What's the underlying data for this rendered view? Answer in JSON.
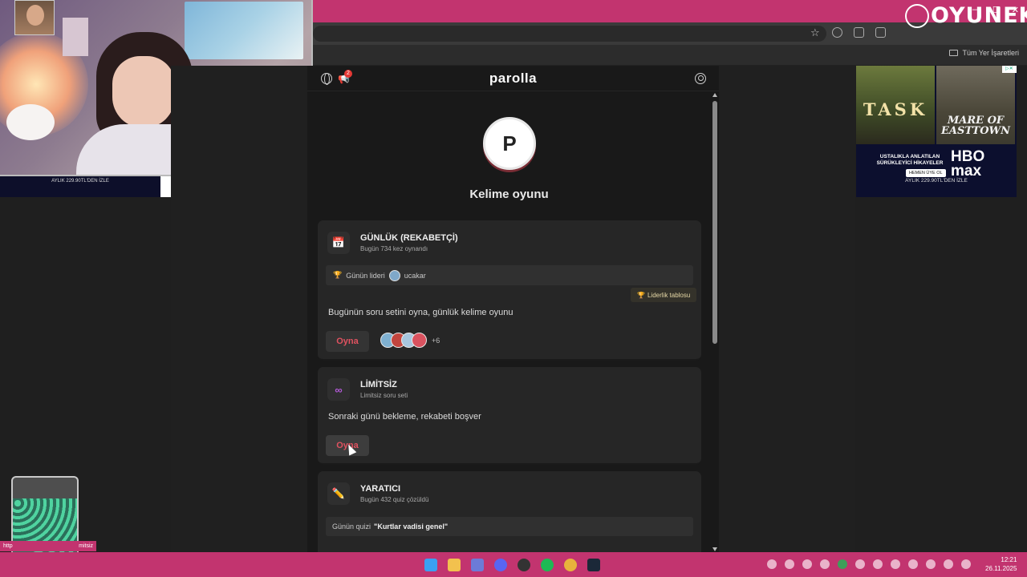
{
  "browser": {
    "bookmark_folder": "Tüm Yer İşaretleri"
  },
  "brand": {
    "text": "OYUNEKS"
  },
  "left_ad": {
    "price": "AYLIK 229.90TL'DEN İZLE"
  },
  "ad": {
    "poster1_title": "TASK",
    "poster2_title": "MARE OF EASTTOWN",
    "tagline": "USTALIKLA ANLATILAN SÜRÜKLEYİCİ HİKAYELER",
    "cta": "HEMEN ÜYE OL",
    "hbo": "HBO",
    "max": "max",
    "price": "AYLIK 229.90TL'DEN İZLE"
  },
  "app": {
    "logo": "parolla",
    "notification_count": "2",
    "avatar_letter": "P",
    "subtitle": "Kelime oyunu"
  },
  "cards": {
    "daily": {
      "title": "GÜNLÜK (REKABETÇİ)",
      "subtitle": "Bugün 734 kez oynandı",
      "leader_label": "Günün lideri",
      "leader_name": "ucakar",
      "leaderboard_button": "Liderlik tablosu",
      "description": "Bugünün soru setini oyna, günlük kelime oyunu",
      "play": "Oyna",
      "more_players": "+6"
    },
    "unlimited": {
      "title": "LİMİTSİZ",
      "subtitle": "Limitsiz soru seti",
      "description": "Sonraki günü bekleme, rekabeti boşver",
      "play": "Oyna"
    },
    "creator": {
      "title": "YARATICI",
      "subtitle": "Bugün 432 quiz çözüldü",
      "quiz_label": "Günün quizi",
      "quiz_name": "\"Kurtlar vadisi genel\""
    }
  },
  "overlay": {
    "left_text": "http",
    "right_text": "mitsiz"
  },
  "clock": {
    "time": "12:21",
    "date": "26.11.2025"
  },
  "colors": {
    "accent_pink": "#c2346f",
    "play_red": "#e05260",
    "app_bg": "#191919",
    "card_bg": "#262626"
  }
}
